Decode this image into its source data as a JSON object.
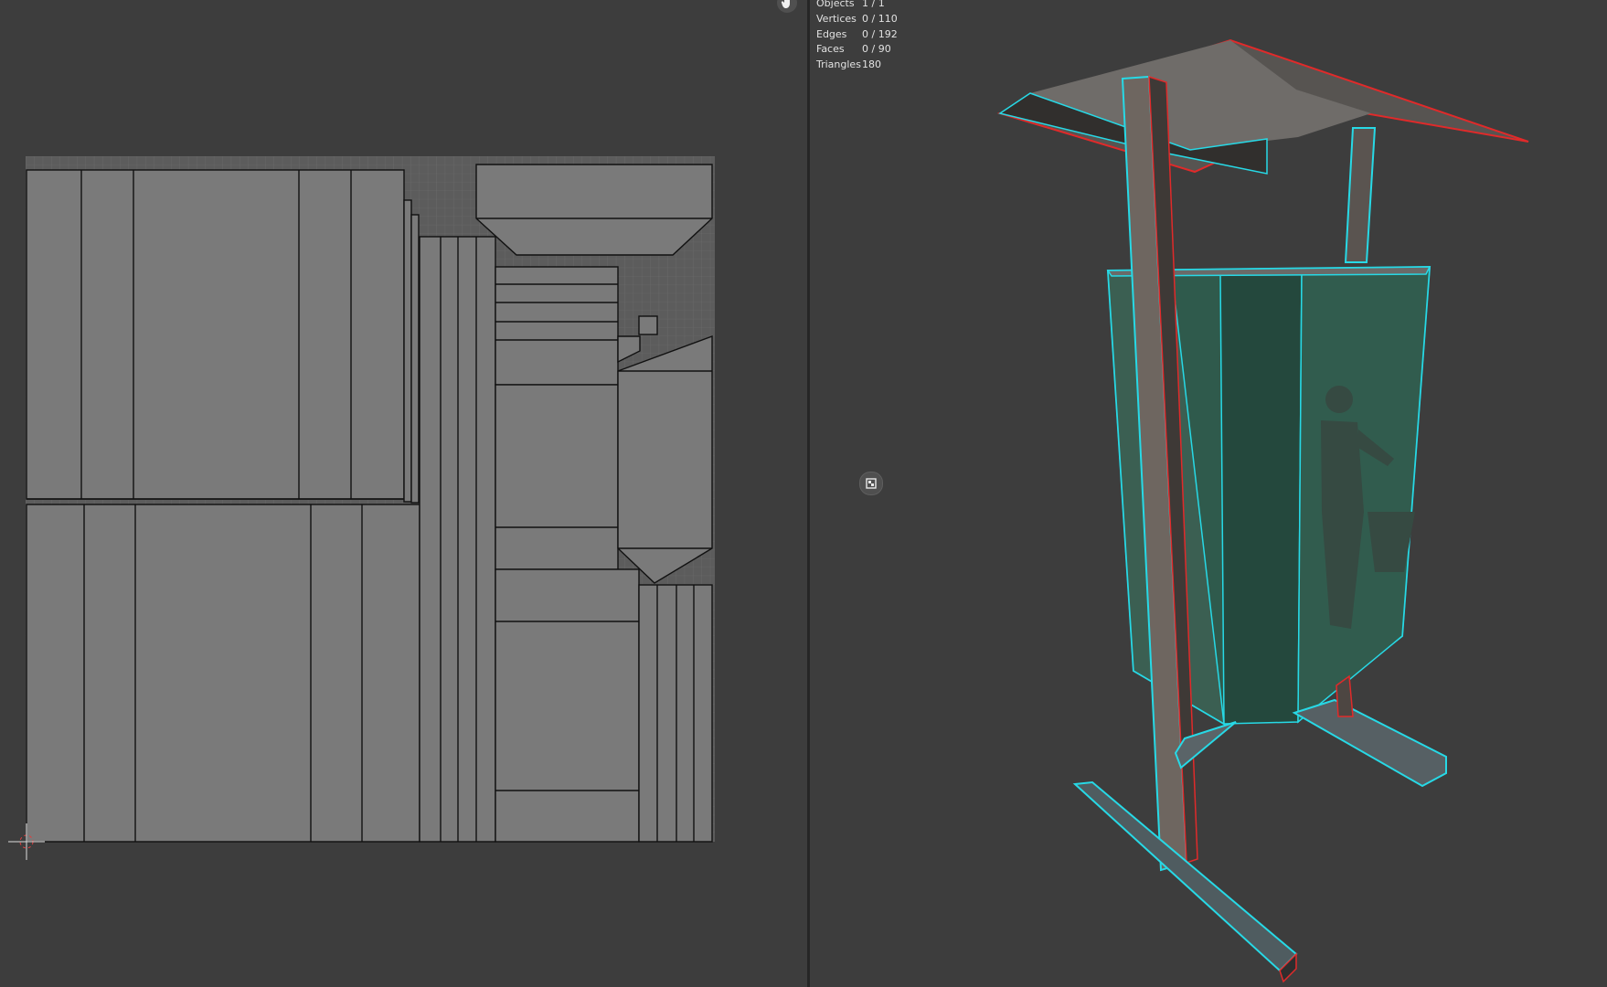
{
  "stats": {
    "objects": {
      "label": "Objects",
      "value": "1 / 1"
    },
    "vertices": {
      "label": "Vertices",
      "value": "0 / 110"
    },
    "edges": {
      "label": "Edges",
      "value": "0 / 192"
    },
    "faces": {
      "label": "Faces",
      "value": "0 / 90"
    },
    "triangles": {
      "label": "Triangles",
      "value": "180"
    }
  },
  "icons": {
    "pan": "hand-icon",
    "overlay": "gizmo-icon",
    "cursor": "3d-cursor-icon"
  },
  "colors": {
    "background": "#3d3d3d",
    "uv_fill": "#7a7a7a",
    "edge_selected_seam": "#e02a2a",
    "edge_wire": "#27d9e6",
    "bin_green": "#2f5a4c"
  }
}
